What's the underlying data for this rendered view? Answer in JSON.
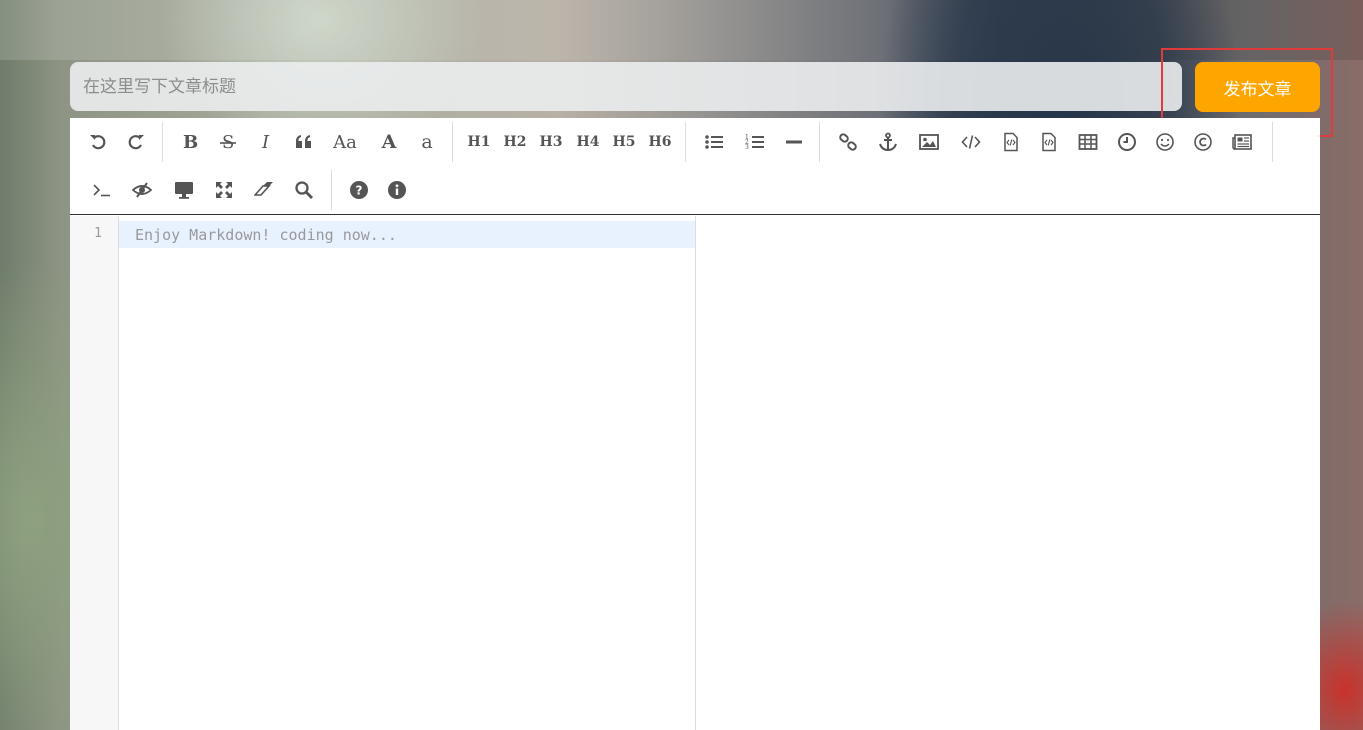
{
  "title_input": {
    "placeholder": "在这里写下文章标题"
  },
  "publish_button": {
    "label": "发布文章",
    "color": "#ffa500"
  },
  "highlight_color": "#e03a3a",
  "toolbar": {
    "row1": [
      {
        "name": "undo-icon",
        "icon": "undo"
      },
      {
        "name": "redo-icon",
        "icon": "redo"
      },
      {
        "name": "bold-icon",
        "icon": "bold"
      },
      {
        "name": "strikethrough-icon",
        "icon": "strike"
      },
      {
        "name": "italic-icon",
        "icon": "italic"
      },
      {
        "name": "quote-icon",
        "icon": "quote"
      },
      {
        "name": "uppercase-icon",
        "text": "Aa"
      },
      {
        "name": "first-uppercase-icon",
        "text": "A"
      },
      {
        "name": "lowercase-icon",
        "text": "a"
      },
      {
        "name": "h1-button",
        "text": "H1"
      },
      {
        "name": "h2-button",
        "text": "H2"
      },
      {
        "name": "h3-button",
        "text": "H3"
      },
      {
        "name": "h4-button",
        "text": "H4"
      },
      {
        "name": "h5-button",
        "text": "H5"
      },
      {
        "name": "h6-button",
        "text": "H6"
      },
      {
        "name": "unordered-list-icon",
        "icon": "ul"
      },
      {
        "name": "ordered-list-icon",
        "icon": "ol"
      },
      {
        "name": "horizontal-rule-icon",
        "icon": "hr"
      },
      {
        "name": "link-icon",
        "icon": "link"
      },
      {
        "name": "anchor-icon",
        "icon": "anchor"
      },
      {
        "name": "image-icon",
        "icon": "image"
      },
      {
        "name": "code-icon",
        "icon": "code"
      },
      {
        "name": "preformatted-code-icon",
        "icon": "filecode"
      },
      {
        "name": "code-block-icon",
        "icon": "filecode"
      },
      {
        "name": "table-icon",
        "icon": "table"
      },
      {
        "name": "datetime-icon",
        "icon": "clock"
      },
      {
        "name": "emoji-icon",
        "icon": "smile"
      },
      {
        "name": "html-entities-icon",
        "icon": "copyright"
      },
      {
        "name": "pagebreak-icon",
        "icon": "newspaper"
      }
    ],
    "row2": [
      {
        "name": "goto-line-icon",
        "icon": "terminal"
      },
      {
        "name": "toggle-preview-icon",
        "icon": "eyeslash"
      },
      {
        "name": "watch-icon",
        "icon": "desktop"
      },
      {
        "name": "fullscreen-icon",
        "icon": "expand"
      },
      {
        "name": "clear-icon",
        "icon": "eraser"
      },
      {
        "name": "search-icon",
        "icon": "search"
      },
      {
        "name": "help-icon",
        "icon": "question"
      },
      {
        "name": "info-icon",
        "icon": "info"
      }
    ]
  },
  "editor": {
    "line_number": "1",
    "placeholder": "Enjoy Markdown! coding now..."
  }
}
